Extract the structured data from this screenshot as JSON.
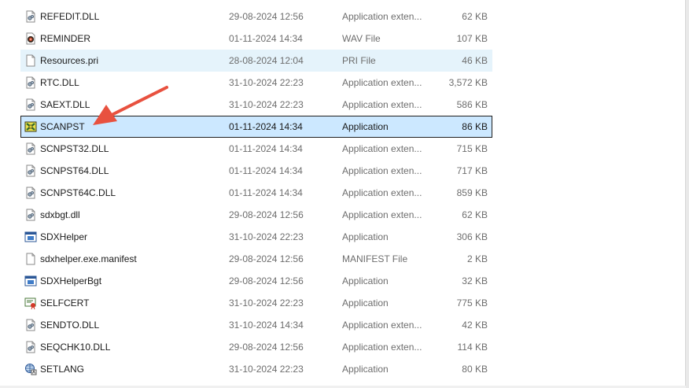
{
  "colors": {
    "arrow": "#e8513f",
    "selection_fill": "#cce8ff",
    "hover_fill": "#e5f3fb"
  },
  "files": [
    {
      "name": "REFEDIT.DLL",
      "date": "29-08-2024 12:56",
      "type": "Application exten...",
      "size": "62 KB",
      "icon": "dll-icon"
    },
    {
      "name": "REMINDER",
      "date": "01-11-2024 14:34",
      "type": "WAV File",
      "size": "107 KB",
      "icon": "audio-file-icon"
    },
    {
      "name": "Resources.pri",
      "date": "28-08-2024 12:04",
      "type": "PRI File",
      "size": "46 KB",
      "icon": "blank-file-icon",
      "state": "hover"
    },
    {
      "name": "RTC.DLL",
      "date": "31-10-2024 22:23",
      "type": "Application exten...",
      "size": "3,572 KB",
      "icon": "dll-icon"
    },
    {
      "name": "SAEXT.DLL",
      "date": "31-10-2024 22:23",
      "type": "Application exten...",
      "size": "586 KB",
      "icon": "dll-icon"
    },
    {
      "name": "SCANPST",
      "date": "01-11-2024 14:34",
      "type": "Application",
      "size": "86 KB",
      "icon": "scanpst-app-icon",
      "state": "selected"
    },
    {
      "name": "SCNPST32.DLL",
      "date": "01-11-2024 14:34",
      "type": "Application exten...",
      "size": "715 KB",
      "icon": "dll-icon"
    },
    {
      "name": "SCNPST64.DLL",
      "date": "01-11-2024 14:34",
      "type": "Application exten...",
      "size": "717 KB",
      "icon": "dll-icon"
    },
    {
      "name": "SCNPST64C.DLL",
      "date": "01-11-2024 14:34",
      "type": "Application exten...",
      "size": "859 KB",
      "icon": "dll-icon"
    },
    {
      "name": "sdxbgt.dll",
      "date": "29-08-2024 12:56",
      "type": "Application exten...",
      "size": "62 KB",
      "icon": "dll-icon"
    },
    {
      "name": "SDXHelper",
      "date": "31-10-2024 22:23",
      "type": "Application",
      "size": "306 KB",
      "icon": "app-window-icon"
    },
    {
      "name": "sdxhelper.exe.manifest",
      "date": "29-08-2024 12:56",
      "type": "MANIFEST File",
      "size": "2 KB",
      "icon": "blank-file-icon"
    },
    {
      "name": "SDXHelperBgt",
      "date": "29-08-2024 12:56",
      "type": "Application",
      "size": "32 KB",
      "icon": "app-window-icon"
    },
    {
      "name": "SELFCERT",
      "date": "31-10-2024 22:23",
      "type": "Application",
      "size": "775 KB",
      "icon": "certificate-icon"
    },
    {
      "name": "SENDTO.DLL",
      "date": "31-10-2024 14:34",
      "type": "Application exten...",
      "size": "42 KB",
      "icon": "dll-icon"
    },
    {
      "name": "SEQCHK10.DLL",
      "date": "29-08-2024 12:56",
      "type": "Application exten...",
      "size": "114 KB",
      "icon": "dll-icon"
    },
    {
      "name": "SETLANG",
      "date": "31-10-2024 22:23",
      "type": "Application",
      "size": "80 KB",
      "icon": "language-globe-icon"
    }
  ]
}
